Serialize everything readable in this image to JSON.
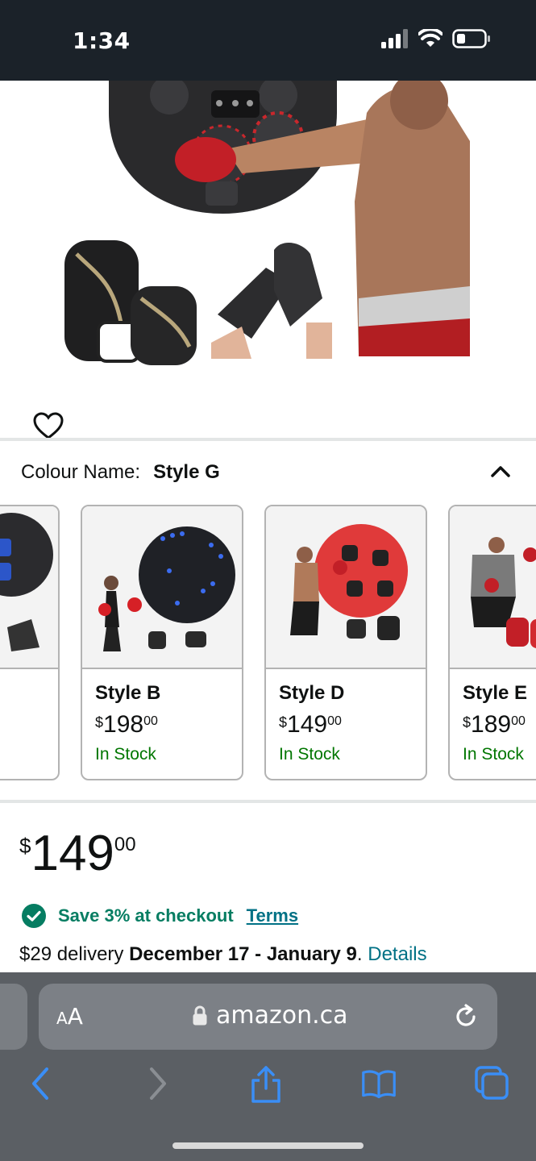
{
  "status_bar": {
    "time": "1:34",
    "icons": [
      "signal-icon",
      "wifi-icon",
      "battery-icon"
    ]
  },
  "hero": {
    "image_description_icons": [
      "boxing-machine",
      "boxing-gloves",
      "mma-gloves"
    ],
    "favorite_icon": "heart-outline-icon",
    "carousel": {
      "total": 7,
      "active_index": 0
    }
  },
  "colour": {
    "label": "Colour Name:",
    "value": "Style G"
  },
  "swatches": [
    {
      "name": "",
      "price_currency": "",
      "price_whole": "",
      "price_cents": "",
      "stock": ""
    },
    {
      "name": "Style B",
      "price_currency": "$",
      "price_whole": "198",
      "price_cents": "00",
      "stock": "In Stock"
    },
    {
      "name": "Style D",
      "price_currency": "$",
      "price_whole": "149",
      "price_cents": "00",
      "stock": "In Stock"
    },
    {
      "name": "Style E",
      "price_currency": "$",
      "price_whole": "189",
      "price_cents": "00",
      "stock": "In Stock"
    }
  ],
  "price": {
    "currency": "$",
    "whole": "149",
    "cents": "00"
  },
  "promo": {
    "save_text": "Save 3% at checkout",
    "terms_label": "Terms"
  },
  "delivery": {
    "prefix": "$29 delivery ",
    "dates": "December 17 - January 9",
    "suffix": ". ",
    "details_label": "Details"
  },
  "browser": {
    "aa_label_big": "A",
    "aa_label_small": "A",
    "url": "amazon.ca"
  },
  "colors": {
    "status_bg": "#1b2229",
    "link": "#007185",
    "in_stock": "#007600",
    "save_green": "#067d62",
    "safari_blue": "#3a8ef6"
  }
}
